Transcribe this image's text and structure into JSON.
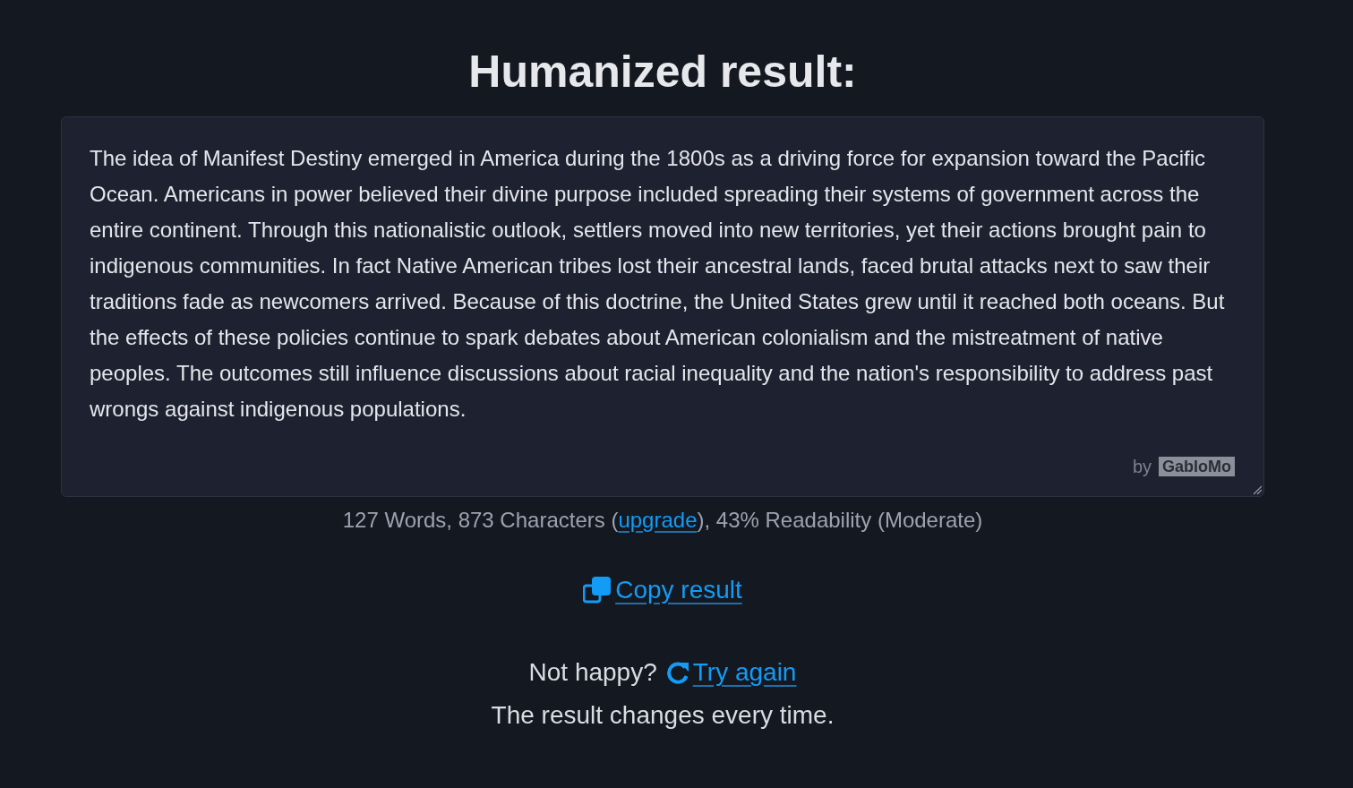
{
  "title": "Humanized result:",
  "result": {
    "text": "The idea of Manifest Destiny emerged in America during the 1800s as a driving force for expansion toward the Pacific Ocean. Americans in power believed their divine purpose included spreading their systems of government across the entire continent. Through this nationalistic outlook, settlers moved into new territories, yet their actions brought pain to indigenous communities. In fact Native American tribes lost their ancestral lands, faced brutal attacks next to saw their traditions fade as newcomers arrived. Because of this doctrine, the United States grew until it reached both oceans. But the effects of these policies continue to spark debates about American colonialism and the mistreatment of native peoples. The outcomes still influence discussions about racial inequality and the nation's responsibility to address past wrongs against indigenous populations.",
    "badge": {
      "prefix": "by",
      "brand": "GabloMo"
    }
  },
  "stats": {
    "text_before": "127 Words, 873 Characters (",
    "link": "upgrade",
    "text_after": "), 43% Readability (Moderate)"
  },
  "copy_button": {
    "label": "Copy result"
  },
  "retry": {
    "prompt": "Not happy?",
    "link": "Try again"
  },
  "note": "The result changes every time."
}
